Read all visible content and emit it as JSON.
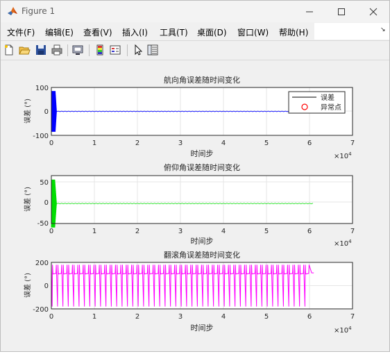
{
  "window": {
    "title": "Figure 1"
  },
  "menu": [
    {
      "label": "文件(F)"
    },
    {
      "label": "编辑(E)"
    },
    {
      "label": "查看(V)"
    },
    {
      "label": "插入(I)"
    },
    {
      "label": "工具(T)"
    },
    {
      "label": "桌面(D)"
    },
    {
      "label": "窗口(W)"
    },
    {
      "label": "帮助(H)"
    }
  ],
  "toolbar": {
    "buttons": [
      "new-figure-icon",
      "open-file-icon",
      "save-icon",
      "print-icon",
      "print-preview-icon",
      "insert-colorbar-icon",
      "insert-legend-icon",
      "edit-plot-pointer-icon",
      "property-inspector-icon"
    ]
  },
  "colors": {
    "heading": "#0000ff",
    "pitch": "#00dd00",
    "roll": "#ff00ff",
    "legend_line": "#000000",
    "legend_marker": "#ff0000"
  },
  "chart_data": [
    {
      "type": "line",
      "title": "航向角误差随时间变化",
      "xlabel": "时间步",
      "ylabel": "误差 (°)",
      "xlim": [
        0,
        70000
      ],
      "ylim": [
        -100,
        100
      ],
      "x_ticks": [
        "0",
        "1",
        "2",
        "3",
        "4",
        "5",
        "6",
        "7"
      ],
      "y_ticks": [
        "100",
        "0",
        "-100"
      ],
      "x_exponent": "×10",
      "x_exponent_power": "4",
      "grid": true,
      "legend_position": "top-right",
      "legend": [
        "误差",
        "异常点"
      ],
      "series": [
        {
          "name": "误差",
          "description": "large oscillation ±85 for first ~1000 steps, then ~0 until ~61000",
          "x_end": 61000
        }
      ]
    },
    {
      "type": "line",
      "title": "俯仰角误差随时间变化",
      "xlabel": "时间步",
      "ylabel": "误差 (°)",
      "xlim": [
        0,
        70000
      ],
      "ylim": [
        -50,
        70
      ],
      "x_ticks": [
        "0",
        "1",
        "2",
        "3",
        "4",
        "5",
        "6",
        "7"
      ],
      "y_ticks": [
        "50",
        "0",
        "-50"
      ],
      "x_exponent": "×10",
      "x_exponent_power": "4",
      "grid": true,
      "series": [
        {
          "name": "误差",
          "description": "large oscillation about ±60 for first ~1000 steps, then ~0 until ~61000",
          "x_end": 61000
        }
      ]
    },
    {
      "type": "line",
      "title": "翻滚角误差随时间变化",
      "xlabel": "时间步",
      "ylabel": "误差 (°)",
      "xlim": [
        0,
        70000
      ],
      "ylim": [
        -200,
        200
      ],
      "x_ticks": [
        "0",
        "1",
        "2",
        "3",
        "4",
        "5",
        "6",
        "7"
      ],
      "y_ticks": [
        "200",
        "0",
        "-200"
      ],
      "x_exponent": "×10",
      "x_exponent_power": "4",
      "grid": true,
      "series": [
        {
          "name": "误差",
          "description": "sawtooth wrap-around between ~+180 and ~-180 with baseline ~+100, about 48 spikes up to x≈60000, flat ~110 afterward to 61000",
          "x_end": 61000,
          "baseline": 100,
          "spike_max": 180,
          "spike_min": -180,
          "spike_count": 48
        }
      ]
    }
  ]
}
